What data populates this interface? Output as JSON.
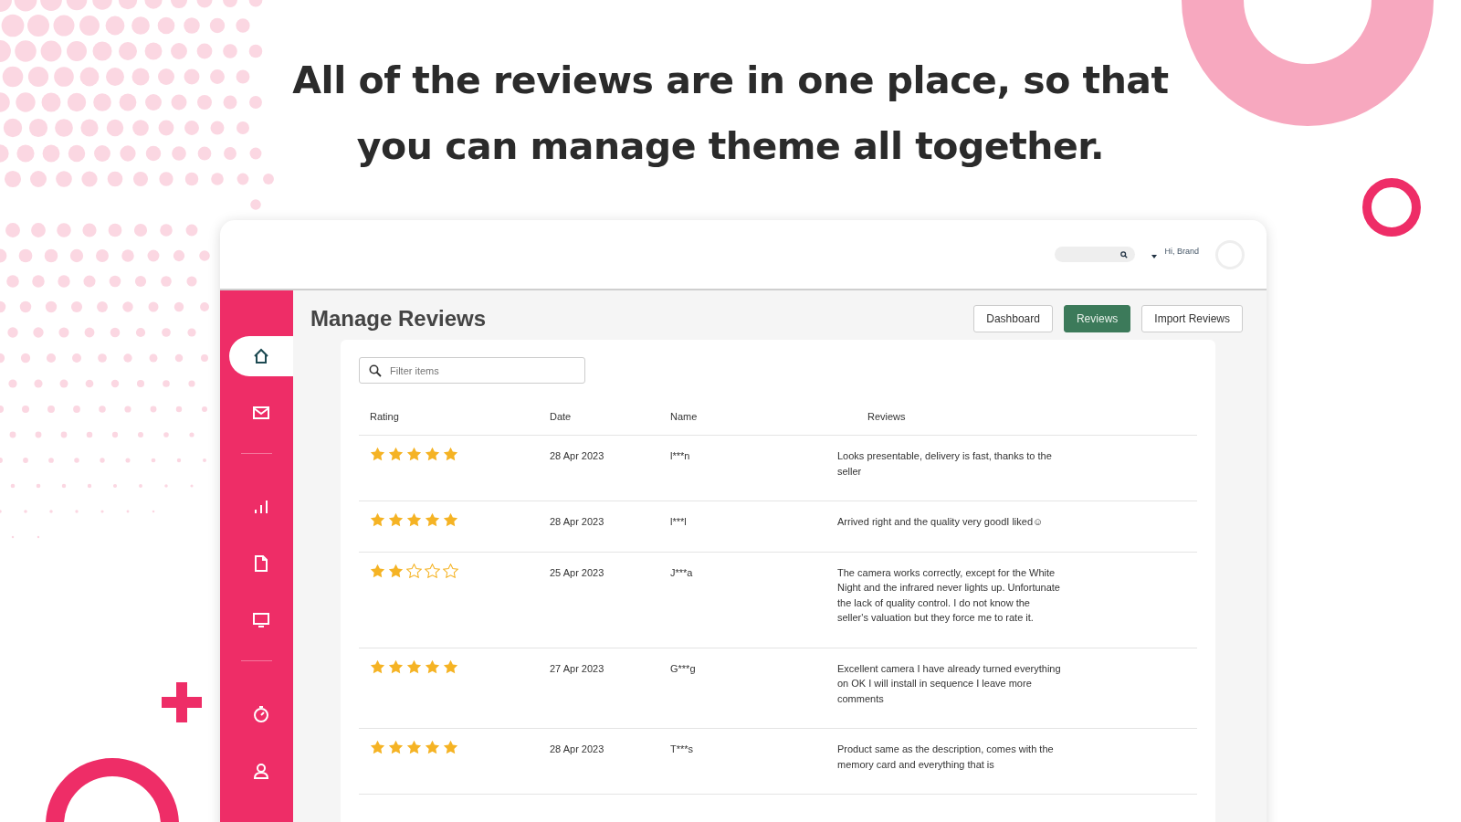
{
  "headline": "All of the reviews are in one place, so that you can manage theme all together.",
  "header": {
    "greeting": "Hi, Brand"
  },
  "sidebar": {
    "items": [
      {
        "selected": true
      },
      {
        "selected": false
      },
      {
        "selected": false
      },
      {
        "selected": false
      },
      {
        "selected": false
      },
      {
        "selected": false
      },
      {
        "selected": false
      }
    ]
  },
  "page_title": "Manage Reviews",
  "tabs": [
    {
      "label": "Dashboard",
      "selected": false
    },
    {
      "label": "Reviews",
      "selected": true
    },
    {
      "label": "Import Reviews",
      "selected": false
    }
  ],
  "search": {
    "placeholder": "Filter items"
  },
  "table": {
    "columns": [
      "Rating",
      "Date",
      "Name",
      "Reviews"
    ],
    "rows": [
      {
        "stars": 5,
        "date": "28 Apr 2023",
        "name": "l***n",
        "review": "Looks presentable, delivery is fast, thanks to the seller"
      },
      {
        "stars": 5,
        "date": "28 Apr 2023",
        "name": "l***l",
        "review": "Arrived right and the quality very goodI liked☺"
      },
      {
        "stars": 2,
        "date": "25 Apr 2023",
        "name": "J***a",
        "review": "The camera works correctly, except for the White Night and the infrared never lights up. Unfortunate the lack of quality control. I do not know the seller's valuation but they force me to rate it."
      },
      {
        "stars": 5,
        "date": "27 Apr 2023",
        "name": "G***g",
        "review": "Excellent camera I have already turned everything on OK I will install in sequence I leave more comments"
      },
      {
        "stars": 5,
        "date": "28 Apr 2023",
        "name": "T***s",
        "review": "Product same as the description, comes with the memory card and everything that is"
      }
    ]
  }
}
